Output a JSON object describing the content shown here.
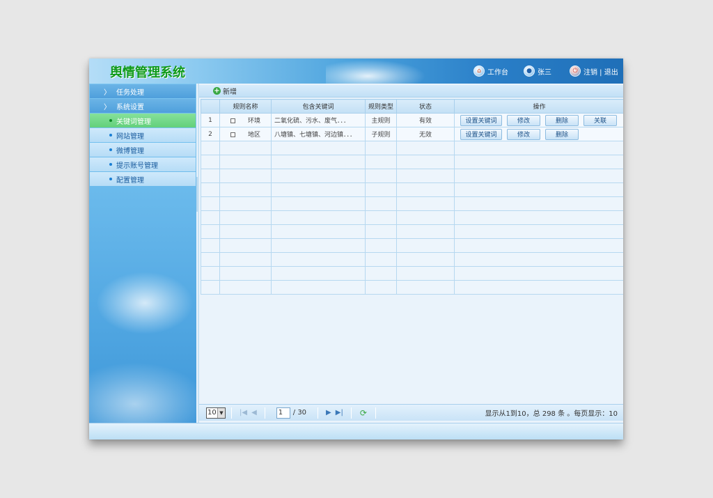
{
  "header": {
    "title": "舆情管理系统",
    "workbench": "工作台",
    "user": "张三",
    "logout": "注销 | 退出",
    "icons": {
      "workbench": "home-icon",
      "user": "user-icon",
      "logout": "power-icon"
    }
  },
  "sidebar": {
    "groups": [
      {
        "label": "任务处理"
      },
      {
        "label": "系统设置"
      }
    ],
    "items": [
      {
        "label": "关键词管理",
        "active": true
      },
      {
        "label": "网站管理"
      },
      {
        "label": "微博管理"
      },
      {
        "label": "提示账号管理"
      },
      {
        "label": "配置管理"
      }
    ]
  },
  "toolbar": {
    "add_label": "新增"
  },
  "table": {
    "headers": [
      "规则名称",
      "包含关键词",
      "规则类型",
      "状态",
      "操作"
    ],
    "rows": [
      {
        "index": "1",
        "name": "环境",
        "keywords": "二氧化硫、污水、废气．．．",
        "type": "主规则",
        "status": "有效",
        "ops": [
          "设置关键词",
          "修改",
          "删除",
          "关联"
        ]
      },
      {
        "index": "2",
        "name": "地区",
        "keywords": "八塘镇、七塘镇、河边镇．．．",
        "type": "子规则",
        "status": "无效",
        "ops": [
          "设置关键词",
          "修改",
          "删除"
        ]
      }
    ],
    "empty_rows": 11
  },
  "pager": {
    "page_size": "10",
    "current_page": "1",
    "total_pages": "/ 30",
    "info": "显示从1到10，总 298 条 。每页显示：10"
  },
  "colors": {
    "logo": "#0e9a1a",
    "accent": "#2a7fc8",
    "active_nav": "#63d07b"
  }
}
